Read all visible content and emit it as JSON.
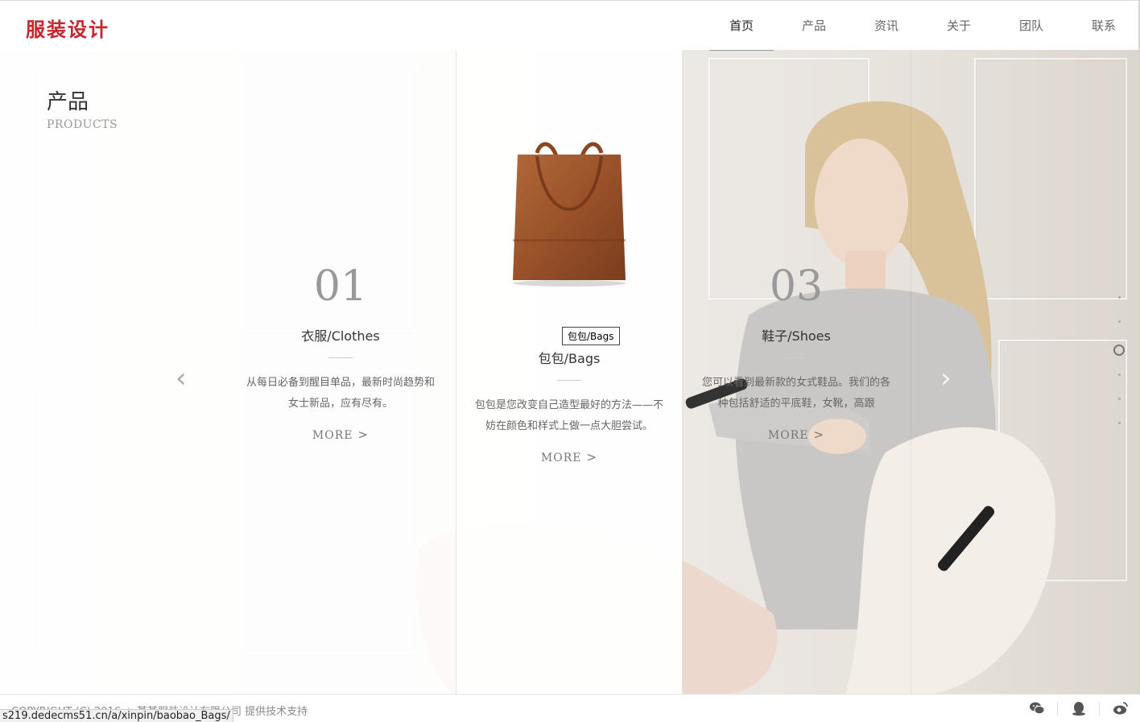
{
  "header": {
    "logo": "服装设计",
    "nav": [
      {
        "label": "首页",
        "active": true
      },
      {
        "label": "产品",
        "active": false
      },
      {
        "label": "资讯",
        "active": false
      },
      {
        "label": "关于",
        "active": false
      },
      {
        "label": "团队",
        "active": false
      },
      {
        "label": "联系",
        "active": false
      }
    ]
  },
  "section": {
    "title": "产品",
    "subtitle": "PRODUCTS"
  },
  "products": [
    {
      "number": "01",
      "name": "衣服/Clothes",
      "desc": "从每日必备到醒目单品，最新时尚趋势和女士新品，应有尽有。",
      "more": "MORE"
    },
    {
      "name": "包包/Bags",
      "desc": "包包是您改变自己造型最好的方法——不妨在颜色和样式上做一点大胆尝试。",
      "more": "MORE",
      "tooltip": "包包/Bags"
    },
    {
      "number": "03",
      "name": "鞋子/Shoes",
      "desc": "您可以看到最新款的女式鞋品。我们的各种包括舒适的平底鞋，女靴，高跟",
      "more": "MORE"
    }
  ],
  "footer": {
    "copyright": "COPYRIGHT (C) 2016 ☆ 某某服装设计有限公司 提供技术支持",
    "status_url": "s219.dedecms51.cn/a/xinpin/baobao_Bags/"
  },
  "icons": [
    "wechat-icon",
    "qq-icon",
    "weibo-icon"
  ],
  "colors": {
    "brand": "#c8242c"
  }
}
